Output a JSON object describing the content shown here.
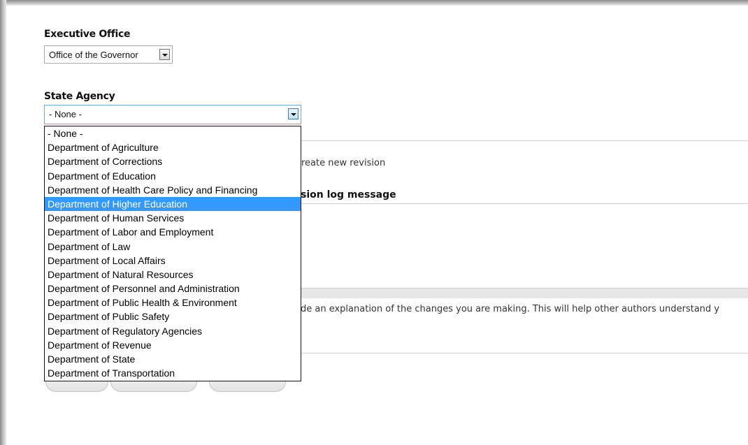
{
  "executive_office": {
    "label": "Executive Office",
    "selected": "Office of the Governor"
  },
  "state_agency": {
    "label": "State Agency",
    "selected": "- None -",
    "options": [
      "- None -",
      "Department of Agriculture",
      "Department of Corrections",
      "Department of Education",
      "Department of Health Care Policy and Financing",
      "Department of Higher Education",
      "Department of Human Services",
      "Department of Labor and Employment",
      "Department of Law",
      "Department of Local Affairs",
      "Department of Natural Resources",
      "Department of Personnel and Administration",
      "Department of Public Health & Environment",
      "Department of Public Safety",
      "Department of Regulatory Agencies",
      "Department of Revenue",
      "Department of State",
      "Department of Transportation"
    ],
    "highlighted_index": 5
  },
  "revision": {
    "checkbox_label_fragment": "reate new revision",
    "log_label_fragment": "sion log message",
    "description_fragment": "de an explanation of the changes you are making. This will help other authors understand y"
  },
  "colors": {
    "highlight": "#3399ff"
  }
}
